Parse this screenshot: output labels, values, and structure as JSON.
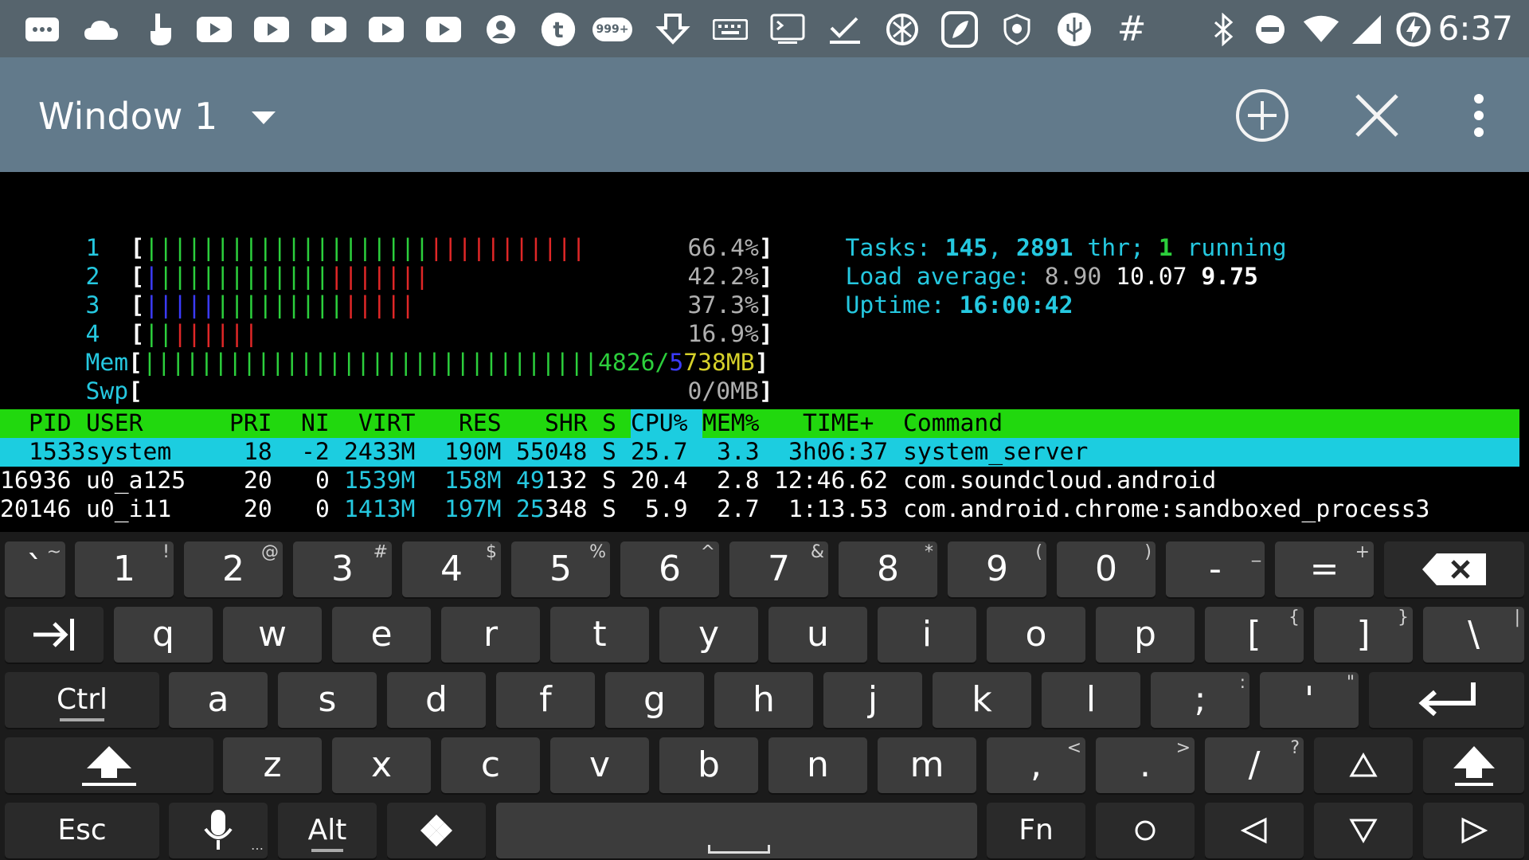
{
  "status_bar": {
    "icons": [
      "message-icon",
      "cloud-icon",
      "usb-hand-icon",
      "youtube-icon",
      "youtube-icon",
      "youtube-icon",
      "youtube-icon",
      "youtube-icon",
      "account-icon",
      "tumblr-icon",
      "notifications-count-icon",
      "download-icon",
      "keyboard-icon",
      "terminal-icon",
      "check-icon",
      "aperture-icon",
      "leaf-app-icon",
      "shield-icon",
      "usb-icon",
      "hash-icon"
    ],
    "badge": "999+",
    "right_icons": [
      "bluetooth-icon",
      "do-not-disturb-icon",
      "wifi-icon",
      "signal-icon",
      "battery-charging-icon"
    ],
    "time": "6:37"
  },
  "toolbar": {
    "title": "Window 1",
    "add_icon": "add-circle-icon",
    "close_icon": "close-icon",
    "menu_icon": "more-vert-icon"
  },
  "terminal": {
    "cpu_rows": [
      {
        "label": "1",
        "value": "66.4%"
      },
      {
        "label": "2",
        "value": "42.2%"
      },
      {
        "label": "3",
        "value": "37.3%"
      },
      {
        "label": "4",
        "value": "16.9%"
      }
    ],
    "mem": {
      "label": "Mem",
      "used": "4826",
      "sep": "/",
      "total_a": "5",
      "total_b": "738MB"
    },
    "swp": {
      "label": "Swp",
      "value": "0/0MB"
    },
    "tasks_label": "Tasks:",
    "tasks_count": "145",
    "threads_count": "2891",
    "threads_label": "thr;",
    "running_count": "1",
    "running_label": "running",
    "load_label": "Load average:",
    "load1": "8.90",
    "load5": "10.07",
    "load15": "9.75",
    "uptime_label": "Uptime:",
    "uptime": "16:00:42",
    "columns": [
      "PID",
      "USER",
      "PRI",
      "NI",
      "VIRT",
      "RES",
      "SHR",
      "S",
      "CPU%",
      "MEM%",
      "TIME+",
      "Command"
    ],
    "processes": [
      {
        "pid": "1533",
        "user": "system",
        "pri": "18",
        "ni": "-2",
        "virt": "2433M",
        "res": "190M",
        "shr": "55048",
        "s": "S",
        "cpu": "25.7",
        "mem": "3.3",
        "time": "3h06:37",
        "cmd": "system_server"
      },
      {
        "pid": "16936",
        "user": "u0_a125",
        "pri": "20",
        "ni": "0",
        "virt": "1539M",
        "res": "158M",
        "shr_a": "49",
        "shr_b": "132",
        "s": "S",
        "cpu": "20.4",
        "mem": "2.8",
        "time": "12:46.62",
        "cmd": "com.soundcloud.android"
      },
      {
        "pid": "20146",
        "user": "u0_i11",
        "pri": "20",
        "ni": "0",
        "virt": "1413M",
        "res": "197M",
        "shr_a": "25",
        "shr_b": "348",
        "s": "S",
        "cpu": "5.9",
        "mem": "2.7",
        "time": "1:13.53",
        "cmd": "com.android.chrome:sandboxed_process3"
      }
    ]
  },
  "keyboard": {
    "row1": [
      [
        "`",
        "~"
      ],
      [
        "1",
        "!"
      ],
      [
        "2",
        "@"
      ],
      [
        "3",
        "#"
      ],
      [
        "4",
        "$"
      ],
      [
        "5",
        "%"
      ],
      [
        "6",
        "^"
      ],
      [
        "7",
        "&"
      ],
      [
        "8",
        "*"
      ],
      [
        "9",
        "("
      ],
      [
        "0",
        ")"
      ],
      [
        "-",
        "_"
      ],
      [
        "=",
        "+"
      ]
    ],
    "row2": [
      [
        "q",
        ""
      ],
      [
        "w",
        ""
      ],
      [
        "e",
        ""
      ],
      [
        "r",
        ""
      ],
      [
        "t",
        ""
      ],
      [
        "y",
        ""
      ],
      [
        "u",
        ""
      ],
      [
        "i",
        ""
      ],
      [
        "o",
        ""
      ],
      [
        "p",
        ""
      ],
      [
        "[",
        "{"
      ],
      [
        "]",
        "}"
      ],
      [
        "\\",
        "|"
      ]
    ],
    "row3": [
      [
        "a",
        ""
      ],
      [
        "s",
        ""
      ],
      [
        "d",
        ""
      ],
      [
        "f",
        ""
      ],
      [
        "g",
        ""
      ],
      [
        "h",
        ""
      ],
      [
        "j",
        ""
      ],
      [
        "k",
        ""
      ],
      [
        "l",
        ""
      ],
      [
        ";",
        ":"
      ],
      [
        "'",
        "\""
      ]
    ],
    "row4": [
      [
        "z",
        ""
      ],
      [
        "x",
        ""
      ],
      [
        "c",
        ""
      ],
      [
        "v",
        ""
      ],
      [
        "b",
        ""
      ],
      [
        "n",
        ""
      ],
      [
        "m",
        ""
      ],
      [
        ",",
        "<"
      ],
      [
        ".",
        ">"
      ],
      [
        "/",
        "?"
      ]
    ],
    "ctrl": "Ctrl",
    "esc": "Esc",
    "alt": "Alt",
    "fn": "Fn"
  }
}
